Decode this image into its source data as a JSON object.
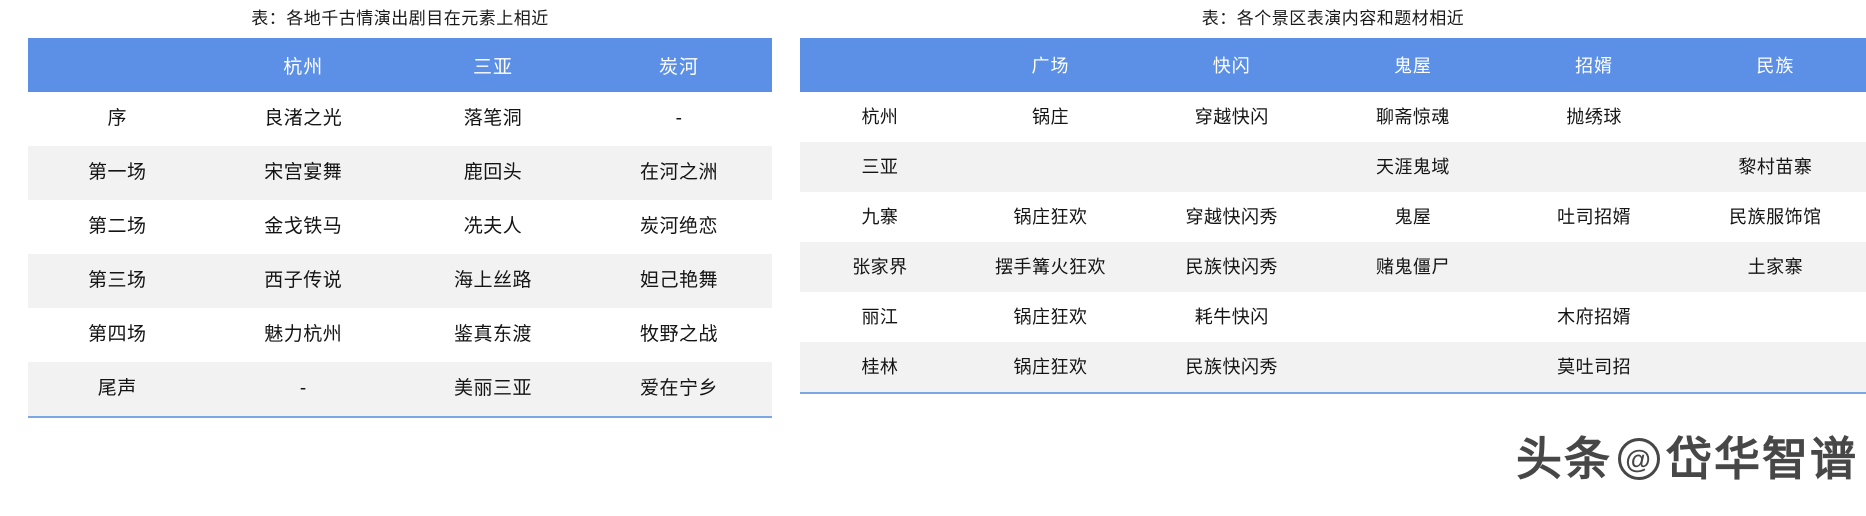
{
  "left_table": {
    "title": "表：各地千古情演出剧目在元素上相近",
    "header": [
      "",
      "杭州",
      "三亚",
      "炭河"
    ],
    "rows": [
      [
        "序",
        "良渚之光",
        "落笔洞",
        "-"
      ],
      [
        "第一场",
        "宋宫宴舞",
        "鹿回头",
        "在河之洲"
      ],
      [
        "第二场",
        "金戈铁马",
        "冼夫人",
        "炭河绝恋"
      ],
      [
        "第三场",
        "西子传说",
        "海上丝路",
        "妲己艳舞"
      ],
      [
        "第四场",
        "魅力杭州",
        "鉴真东渡",
        "牧野之战"
      ],
      [
        "尾声",
        "-",
        "美丽三亚",
        "爱在宁乡"
      ]
    ]
  },
  "right_table": {
    "title": "表：各个景区表演内容和题材相近",
    "header": [
      "",
      "广场",
      "快闪",
      "鬼屋",
      "招婿",
      "民族"
    ],
    "rows": [
      [
        "杭州",
        "锅庄",
        "穿越快闪",
        "聊斋惊魂",
        "抛绣球",
        ""
      ],
      [
        "三亚",
        "",
        "",
        "天涯鬼域",
        "",
        "黎村苗寨"
      ],
      [
        "九寨",
        "锅庄狂欢",
        "穿越快闪秀",
        "鬼屋",
        "吐司招婿",
        "民族服饰馆"
      ],
      [
        "张家界",
        "摆手篝火狂欢",
        "民族快闪秀",
        "赌鬼僵尸",
        "",
        "土家寨"
      ],
      [
        "丽江",
        "锅庄狂欢",
        "耗牛快闪",
        "",
        "木府招婿",
        ""
      ],
      [
        "桂林",
        "锅庄狂欢",
        "民族快闪秀",
        "",
        "莫吐司招",
        ""
      ]
    ]
  },
  "watermark": {
    "brand": "头条",
    "at_symbol": "@",
    "account": "岱华智谱"
  },
  "colors": {
    "header_blue": "#5B90E6",
    "row_alt": "#F2F2F2",
    "bottom_rule": "#7BA7E3",
    "text": "#141414"
  }
}
